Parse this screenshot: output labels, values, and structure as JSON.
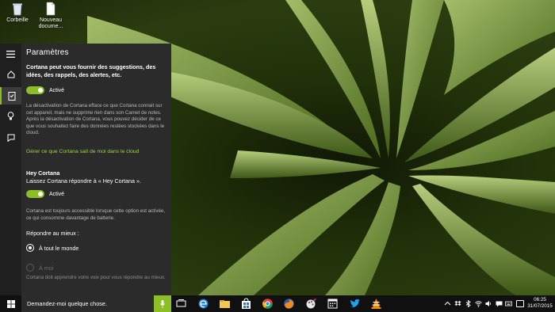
{
  "desktop": {
    "icons": [
      {
        "label": "Corbeille",
        "icon": "recycle-bin-icon"
      },
      {
        "label": "Nouveau docume...",
        "icon": "document-icon"
      }
    ]
  },
  "cortana": {
    "title": "Paramètres",
    "rail": [
      "hamburger-menu-icon",
      "home-icon",
      "notebook-icon",
      "lightbulb-icon",
      "feedback-icon"
    ],
    "intro": "Cortana peut vous fournir des suggestions, des idées, des rappels, des alertes, etc.",
    "toggle1": "Activé",
    "desc1": "La désactivation de Cortana efface ce que Cortana connait sur cet appareil, mais ne supprime rien dans son Carnet de notes. Après la désactivation de Cortana, vous pouvez décider de ce que vous souhaitez faire des données restées stockées dans le cloud.",
    "link": "Gérer ce que Cortana sait de moi dans le cloud",
    "hey_title": "Hey Cortana",
    "hey_desc": "Laissez Cortana répondre à « Hey Cortana ».",
    "toggle2": "Activé",
    "desc2": "Cortana est toujours accessible lorsque cette option est activée, ce qui consomme davantage de batterie.",
    "respond_label": "Répondre au mieux :",
    "radio1": "À tout le monde",
    "radio2": "À moi",
    "desc3": "Cortana doit apprendre votre voix pour vous répondre au mieux."
  },
  "taskbar": {
    "search_placeholder": "Demandez-moi quelque chose.",
    "apps": [
      "task-view-icon",
      "edge-icon",
      "file-explorer-icon",
      "store-icon",
      "chrome-icon",
      "firefox-icon",
      "paint-icon",
      "calendar-icon",
      "twitter-icon",
      "vlc-icon"
    ],
    "time": "06:25",
    "date": "31/07/2015"
  },
  "colors": {
    "accent": "#8cbf26",
    "panel": "#2b2b2b",
    "taskbar": "#101010"
  }
}
